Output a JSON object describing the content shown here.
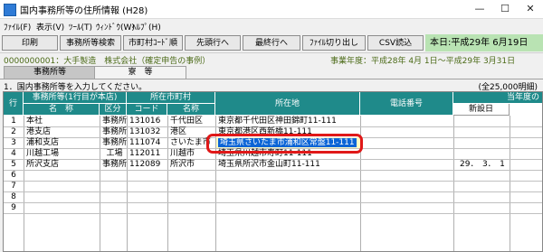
{
  "window": {
    "title": "国内事務所等の住所情報 (H28)",
    "controls": {
      "minimize": "—",
      "maximize": "☐",
      "close": "✕"
    }
  },
  "menu": [
    "ﾌｧｲﾙ(F)",
    "表示(V)",
    "ﾂｰﾙ(T)",
    "ｳｨﾝﾄﾞｳ(W)",
    "ﾍﾙﾌﾟ(H)"
  ],
  "toolbar": {
    "print": "印刷",
    "office_search": "事務所等検索",
    "city_code_order": "市町村ｺｰﾄﾞ順",
    "first_row": "先頭行へ",
    "last_row": "最終行へ",
    "file_switch": "ﾌｧｲﾙ切り出し",
    "csv_import": "CSV読込",
    "today": "本日:平成29年 6月19日(月)"
  },
  "corp_line": "0000000001：大手製造　株式会社（確定申告の事例）",
  "fiscal_year": "事業年度：平成28年 4月 1日～平成29年 3月31日",
  "tabs": {
    "office": "事務所等",
    "dorm": "寮　等"
  },
  "instruction": "1．国内事務所等を入力してください。",
  "limit": "(全25,000明細)",
  "headers": {
    "row": "行",
    "office_group": "事務所等(1行目が本店)",
    "city_group": "所在市町村",
    "address": "所在地",
    "phone": "電話番号",
    "current_year": "当年度の",
    "name": "名　称",
    "category": "区分",
    "code": "コード",
    "city_name": "名称",
    "new_date": "新設日"
  },
  "rows": [
    {
      "no": "1",
      "name": "本社",
      "category": "事務所",
      "code": "131016",
      "city": "千代田区",
      "address": "東京都千代田区神田錦町11-111",
      "phone": "",
      "new_date": ""
    },
    {
      "no": "2",
      "name": "港支店",
      "category": "事務所",
      "code": "131032",
      "city": "港区",
      "address": "東京都港区西新橋11-111",
      "phone": "",
      "new_date": ""
    },
    {
      "no": "3",
      "name": "浦和支店",
      "category": "事務所",
      "code": "111074",
      "city": "さいたま市",
      "address": "埼玉県さいたま市浦和区常盤11-111",
      "phone": "",
      "new_date": ""
    },
    {
      "no": "4",
      "name": "川越工場",
      "category": "工場",
      "code": "112011",
      "city": "川越市",
      "address": "埼玉県川越市寿町11-111",
      "phone": "",
      "new_date": ""
    },
    {
      "no": "5",
      "name": "所沢支店",
      "category": "事務所",
      "code": "112089",
      "city": "所沢市",
      "address": "埼玉県所沢市金山町11-111",
      "phone": "",
      "new_date": "29．　3．　1"
    },
    {
      "no": "6",
      "name": "",
      "category": "",
      "code": "",
      "city": "",
      "address": "",
      "phone": "",
      "new_date": ""
    },
    {
      "no": "7",
      "name": "",
      "category": "",
      "code": "",
      "city": "",
      "address": "",
      "phone": "",
      "new_date": ""
    },
    {
      "no": "8",
      "name": "",
      "category": "",
      "code": "",
      "city": "",
      "address": "",
      "phone": "",
      "new_date": ""
    },
    {
      "no": "9",
      "name": "",
      "category": "",
      "code": "",
      "city": "",
      "address": "",
      "phone": "",
      "new_date": ""
    }
  ],
  "colors": {
    "header_teal": "#1f8a8a",
    "date_green": "#b9e3b3",
    "selection_blue": "#0a64d6",
    "highlight_red": "#e01818"
  }
}
